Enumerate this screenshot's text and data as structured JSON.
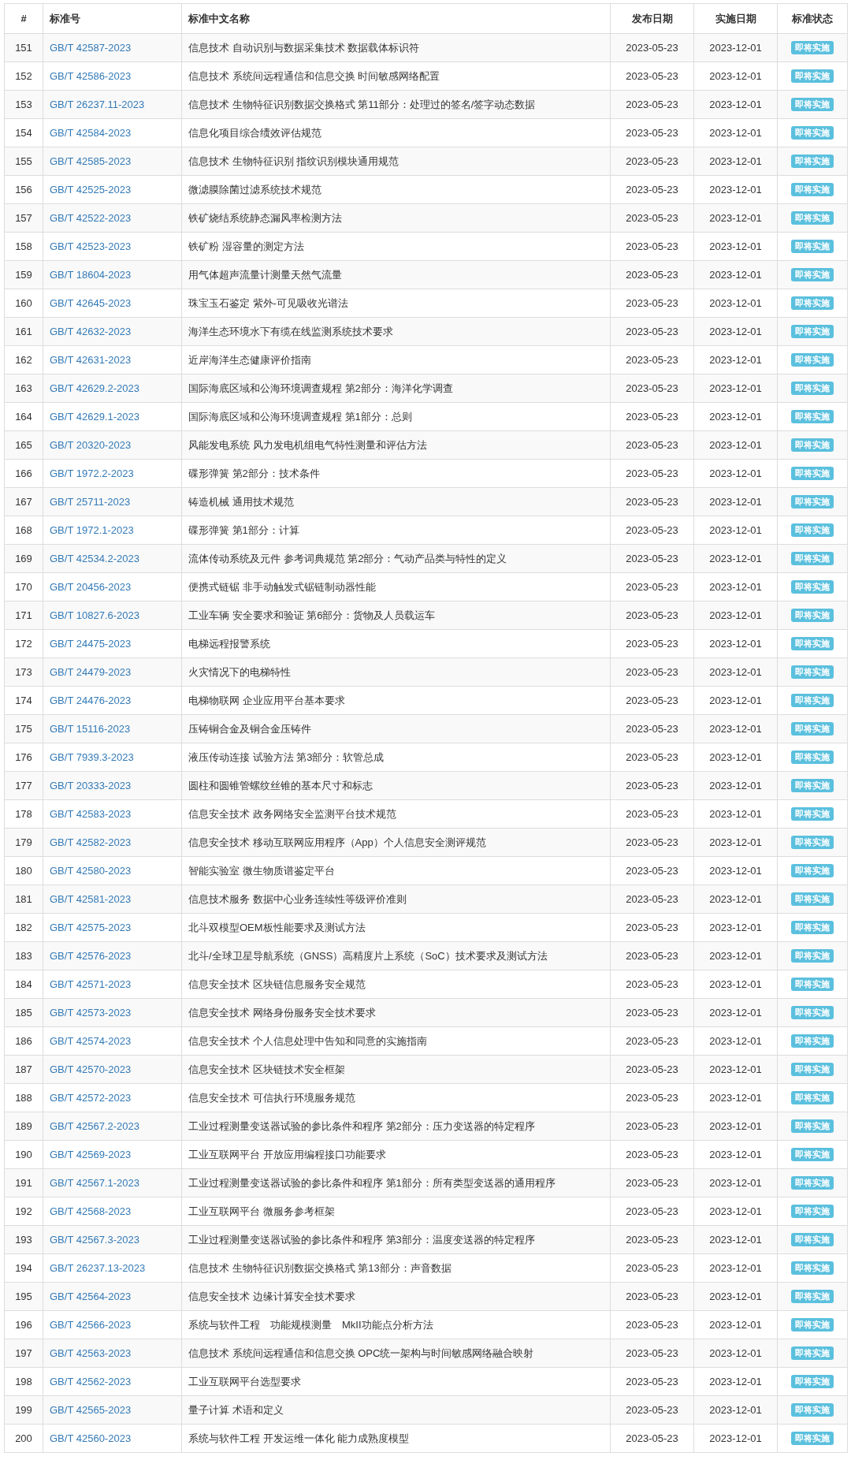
{
  "table": {
    "columns": [
      "#",
      "标准号",
      "标准中文名称",
      "发布日期",
      "实施日期",
      "标准状态"
    ],
    "rows": [
      {
        "no": "151",
        "code": "GB/T 42587-2023",
        "name": "信息技术 自动识别与数据采集技术 数据载体标识符",
        "published": "2023-05-23",
        "effective": "2023-12-01",
        "status": "即将实施"
      },
      {
        "no": "152",
        "code": "GB/T 42586-2023",
        "name": "信息技术 系统间远程通信和信息交换 时间敏感网络配置",
        "published": "2023-05-23",
        "effective": "2023-12-01",
        "status": "即将实施"
      },
      {
        "no": "153",
        "code": "GB/T 26237.11-2023",
        "name": "信息技术 生物特征识别数据交换格式 第11部分：处理过的签名/签字动态数据",
        "published": "2023-05-23",
        "effective": "2023-12-01",
        "status": "即将实施"
      },
      {
        "no": "154",
        "code": "GB/T 42584-2023",
        "name": "信息化项目综合绩效评估规范",
        "published": "2023-05-23",
        "effective": "2023-12-01",
        "status": "即将实施"
      },
      {
        "no": "155",
        "code": "GB/T 42585-2023",
        "name": "信息技术 生物特征识别 指纹识别模块通用规范",
        "published": "2023-05-23",
        "effective": "2023-12-01",
        "status": "即将实施"
      },
      {
        "no": "156",
        "code": "GB/T 42525-2023",
        "name": "微滤膜除菌过滤系统技术规范",
        "published": "2023-05-23",
        "effective": "2023-12-01",
        "status": "即将实施"
      },
      {
        "no": "157",
        "code": "GB/T 42522-2023",
        "name": "铁矿烧结系统静态漏风率检测方法",
        "published": "2023-05-23",
        "effective": "2023-12-01",
        "status": "即将实施"
      },
      {
        "no": "158",
        "code": "GB/T 42523-2023",
        "name": "铁矿粉 湿容量的测定方法",
        "published": "2023-05-23",
        "effective": "2023-12-01",
        "status": "即将实施"
      },
      {
        "no": "159",
        "code": "GB/T 18604-2023",
        "name": "用气体超声流量计测量天然气流量",
        "published": "2023-05-23",
        "effective": "2023-12-01",
        "status": "即将实施"
      },
      {
        "no": "160",
        "code": "GB/T 42645-2023",
        "name": "珠宝玉石鉴定 紫外-可见吸收光谱法",
        "published": "2023-05-23",
        "effective": "2023-12-01",
        "status": "即将实施"
      },
      {
        "no": "161",
        "code": "GB/T 42632-2023",
        "name": "海洋生态环境水下有缆在线监测系统技术要求",
        "published": "2023-05-23",
        "effective": "2023-12-01",
        "status": "即将实施"
      },
      {
        "no": "162",
        "code": "GB/T 42631-2023",
        "name": "近岸海洋生态健康评价指南",
        "published": "2023-05-23",
        "effective": "2023-12-01",
        "status": "即将实施"
      },
      {
        "no": "163",
        "code": "GB/T 42629.2-2023",
        "name": "国际海底区域和公海环境调查规程 第2部分：海洋化学调查",
        "published": "2023-05-23",
        "effective": "2023-12-01",
        "status": "即将实施"
      },
      {
        "no": "164",
        "code": "GB/T 42629.1-2023",
        "name": "国际海底区域和公海环境调查规程 第1部分：总则",
        "published": "2023-05-23",
        "effective": "2023-12-01",
        "status": "即将实施"
      },
      {
        "no": "165",
        "code": "GB/T 20320-2023",
        "name": "风能发电系统 风力发电机组电气特性测量和评估方法",
        "published": "2023-05-23",
        "effective": "2023-12-01",
        "status": "即将实施"
      },
      {
        "no": "166",
        "code": "GB/T 1972.2-2023",
        "name": "碟形弹簧 第2部分：技术条件",
        "published": "2023-05-23",
        "effective": "2023-12-01",
        "status": "即将实施"
      },
      {
        "no": "167",
        "code": "GB/T 25711-2023",
        "name": "铸造机械 通用技术规范",
        "published": "2023-05-23",
        "effective": "2023-12-01",
        "status": "即将实施"
      },
      {
        "no": "168",
        "code": "GB/T 1972.1-2023",
        "name": "碟形弹簧 第1部分：计算",
        "published": "2023-05-23",
        "effective": "2023-12-01",
        "status": "即将实施"
      },
      {
        "no": "169",
        "code": "GB/T 42534.2-2023",
        "name": "流体传动系统及元件 参考词典规范 第2部分：气动产品类与特性的定义",
        "published": "2023-05-23",
        "effective": "2023-12-01",
        "status": "即将实施"
      },
      {
        "no": "170",
        "code": "GB/T 20456-2023",
        "name": "便携式链锯 非手动触发式锯链制动器性能",
        "published": "2023-05-23",
        "effective": "2023-12-01",
        "status": "即将实施"
      },
      {
        "no": "171",
        "code": "GB/T 10827.6-2023",
        "name": "工业车辆 安全要求和验证 第6部分：货物及人员载运车",
        "published": "2023-05-23",
        "effective": "2023-12-01",
        "status": "即将实施"
      },
      {
        "no": "172",
        "code": "GB/T 24475-2023",
        "name": "电梯远程报警系统",
        "published": "2023-05-23",
        "effective": "2023-12-01",
        "status": "即将实施"
      },
      {
        "no": "173",
        "code": "GB/T 24479-2023",
        "name": "火灾情况下的电梯特性",
        "published": "2023-05-23",
        "effective": "2023-12-01",
        "status": "即将实施"
      },
      {
        "no": "174",
        "code": "GB/T 24476-2023",
        "name": "电梯物联网 企业应用平台基本要求",
        "published": "2023-05-23",
        "effective": "2023-12-01",
        "status": "即将实施"
      },
      {
        "no": "175",
        "code": "GB/T 15116-2023",
        "name": "压铸铜合金及铜合金压铸件",
        "published": "2023-05-23",
        "effective": "2023-12-01",
        "status": "即将实施"
      },
      {
        "no": "176",
        "code": "GB/T 7939.3-2023",
        "name": "液压传动连接 试验方法 第3部分：软管总成",
        "published": "2023-05-23",
        "effective": "2023-12-01",
        "status": "即将实施"
      },
      {
        "no": "177",
        "code": "GB/T 20333-2023",
        "name": "圆柱和圆锥管螺纹丝锥的基本尺寸和标志",
        "published": "2023-05-23",
        "effective": "2023-12-01",
        "status": "即将实施"
      },
      {
        "no": "178",
        "code": "GB/T 42583-2023",
        "name": "信息安全技术 政务网络安全监测平台技术规范",
        "published": "2023-05-23",
        "effective": "2023-12-01",
        "status": "即将实施"
      },
      {
        "no": "179",
        "code": "GB/T 42582-2023",
        "name": "信息安全技术 移动互联网应用程序（App）个人信息安全测评规范",
        "published": "2023-05-23",
        "effective": "2023-12-01",
        "status": "即将实施"
      },
      {
        "no": "180",
        "code": "GB/T 42580-2023",
        "name": "智能实验室 微生物质谱鉴定平台",
        "published": "2023-05-23",
        "effective": "2023-12-01",
        "status": "即将实施"
      },
      {
        "no": "181",
        "code": "GB/T 42581-2023",
        "name": "信息技术服务 数据中心业务连续性等级评价准则",
        "published": "2023-05-23",
        "effective": "2023-12-01",
        "status": "即将实施"
      },
      {
        "no": "182",
        "code": "GB/T 42575-2023",
        "name": "北斗双模型OEM板性能要求及测试方法",
        "published": "2023-05-23",
        "effective": "2023-12-01",
        "status": "即将实施"
      },
      {
        "no": "183",
        "code": "GB/T 42576-2023",
        "name": "北斗/全球卫星导航系统（GNSS）高精度片上系统（SoC）技术要求及测试方法",
        "published": "2023-05-23",
        "effective": "2023-12-01",
        "status": "即将实施"
      },
      {
        "no": "184",
        "code": "GB/T 42571-2023",
        "name": "信息安全技术 区块链信息服务安全规范",
        "published": "2023-05-23",
        "effective": "2023-12-01",
        "status": "即将实施"
      },
      {
        "no": "185",
        "code": "GB/T 42573-2023",
        "name": "信息安全技术 网络身份服务安全技术要求",
        "published": "2023-05-23",
        "effective": "2023-12-01",
        "status": "即将实施"
      },
      {
        "no": "186",
        "code": "GB/T 42574-2023",
        "name": "信息安全技术 个人信息处理中告知和同意的实施指南",
        "published": "2023-05-23",
        "effective": "2023-12-01",
        "status": "即将实施"
      },
      {
        "no": "187",
        "code": "GB/T 42570-2023",
        "name": "信息安全技术 区块链技术安全框架",
        "published": "2023-05-23",
        "effective": "2023-12-01",
        "status": "即将实施"
      },
      {
        "no": "188",
        "code": "GB/T 42572-2023",
        "name": "信息安全技术 可信执行环境服务规范",
        "published": "2023-05-23",
        "effective": "2023-12-01",
        "status": "即将实施"
      },
      {
        "no": "189",
        "code": "GB/T 42567.2-2023",
        "name": "工业过程测量变送器试验的参比条件和程序 第2部分：压力变送器的特定程序",
        "published": "2023-05-23",
        "effective": "2023-12-01",
        "status": "即将实施"
      },
      {
        "no": "190",
        "code": "GB/T 42569-2023",
        "name": "工业互联网平台 开放应用编程接口功能要求",
        "published": "2023-05-23",
        "effective": "2023-12-01",
        "status": "即将实施"
      },
      {
        "no": "191",
        "code": "GB/T 42567.1-2023",
        "name": "工业过程测量变送器试验的参比条件和程序 第1部分：所有类型变送器的通用程序",
        "published": "2023-05-23",
        "effective": "2023-12-01",
        "status": "即将实施"
      },
      {
        "no": "192",
        "code": "GB/T 42568-2023",
        "name": "工业互联网平台 微服务参考框架",
        "published": "2023-05-23",
        "effective": "2023-12-01",
        "status": "即将实施"
      },
      {
        "no": "193",
        "code": "GB/T 42567.3-2023",
        "name": "工业过程测量变送器试验的参比条件和程序 第3部分：温度变送器的特定程序",
        "published": "2023-05-23",
        "effective": "2023-12-01",
        "status": "即将实施"
      },
      {
        "no": "194",
        "code": "GB/T 26237.13-2023",
        "name": "信息技术 生物特征识别数据交换格式 第13部分：声音数据",
        "published": "2023-05-23",
        "effective": "2023-12-01",
        "status": "即将实施"
      },
      {
        "no": "195",
        "code": "GB/T 42564-2023",
        "name": "信息安全技术 边缘计算安全技术要求",
        "published": "2023-05-23",
        "effective": "2023-12-01",
        "status": "即将实施"
      },
      {
        "no": "196",
        "code": "GB/T 42566-2023",
        "name": "系统与软件工程　功能规模测量　MkII功能点分析方法",
        "published": "2023-05-23",
        "effective": "2023-12-01",
        "status": "即将实施"
      },
      {
        "no": "197",
        "code": "GB/T 42563-2023",
        "name": "信息技术 系统间远程通信和信息交换 OPC统一架构与时间敏感网络融合映射",
        "published": "2023-05-23",
        "effective": "2023-12-01",
        "status": "即将实施"
      },
      {
        "no": "198",
        "code": "GB/T 42562-2023",
        "name": "工业互联网平台选型要求",
        "published": "2023-05-23",
        "effective": "2023-12-01",
        "status": "即将实施"
      },
      {
        "no": "199",
        "code": "GB/T 42565-2023",
        "name": "量子计算 术语和定义",
        "published": "2023-05-23",
        "effective": "2023-12-01",
        "status": "即将实施"
      },
      {
        "no": "200",
        "code": "GB/T 42560-2023",
        "name": "系统与软件工程 开发运维一体化 能力成熟度模型",
        "published": "2023-05-23",
        "effective": "2023-12-01",
        "status": "即将实施"
      }
    ]
  }
}
